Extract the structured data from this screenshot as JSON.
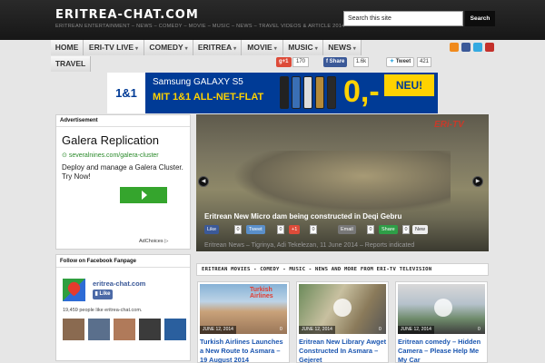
{
  "header": {
    "site_title": "ERITREA-CHAT.COM",
    "tagline": "ERITREAN ENTERTAINMENT – NEWS – COMEDY – MOVIE – MUSIC – NEWS – TRAVEL VIDEOS & ARTICLE 2014",
    "search_value": "Search this site",
    "search_button": "Search"
  },
  "nav": {
    "items": [
      {
        "label": "HOME",
        "dropdown": false
      },
      {
        "label": "ERI-TV LIVE",
        "dropdown": true
      },
      {
        "label": "COMEDY",
        "dropdown": true
      },
      {
        "label": "ERITREA",
        "dropdown": true
      },
      {
        "label": "MOVIE",
        "dropdown": true
      },
      {
        "label": "MUSIC",
        "dropdown": true
      },
      {
        "label": "NEWS",
        "dropdown": true
      },
      {
        "label": "TRAVEL",
        "dropdown": false
      }
    ],
    "social_icons": [
      "rss-icon",
      "facebook-icon",
      "twitter-icon",
      "youtube-icon"
    ]
  },
  "share_bar": {
    "gplus_label": "g+1",
    "gplus_count": "170",
    "fb_label": "Share",
    "fb_count": "1.6k",
    "tweet_label": "Tweet",
    "tweet_count": "421"
  },
  "banner": {
    "brand": "1&1",
    "line1": "Samsung GALAXY S5",
    "line2": "MIT 1&1 ALL-NET-FLAT",
    "price": "0,-",
    "badge": "NEU!",
    "colors": {
      "bg": "#003b96",
      "accent": "#ffd200"
    }
  },
  "ad": {
    "heading": "Advertisement",
    "title": "Galera Replication",
    "url": "severalnines.com/galera-cluster",
    "description": "Deploy and manage a Galera Cluster. Try Now!",
    "choices": "AdChoices"
  },
  "slider": {
    "channel_logo": "ERi-TV",
    "title": "Eritrean New Micro dam being constructed in Deqi Gebru",
    "share_buttons": [
      {
        "label": "Like",
        "count": "0"
      },
      {
        "label": "Tweet",
        "count": "0"
      },
      {
        "label": "+1",
        "count": "0"
      },
      {
        "label": "Email",
        "count": "0"
      },
      {
        "label": "Share",
        "count": "0"
      },
      {
        "label": "New",
        "count": ""
      }
    ],
    "excerpt": "Eritrean News – Tigrinya, Adi Tekelezan, 11 June 2014 – Reports indicated"
  },
  "facebook": {
    "heading": "Follow on Facebook Fanpage",
    "page_name": "eritrea-chat.com",
    "like_label": "Like",
    "count_text": "19,459 people like eritrea-chat.com."
  },
  "section": {
    "heading": "ERITREAN MOVIES - COMEDY - MUSIC - NEWS AND MORE FROM ERI-TV TELEVISION"
  },
  "cards": [
    {
      "date": "JUNE 12, 2014",
      "comments": "0",
      "title": "Turkish Airlines Launches a New Route to Asmara – 19 August 2014",
      "overlay": "Turkish Airlines"
    },
    {
      "date": "JUNE 12, 2014",
      "comments": "0",
      "title": "Eritrean New Library Awget Constructed In Asmara – Gejeret",
      "overlay": ""
    },
    {
      "date": "JUNE 12, 2014",
      "comments": "0",
      "title": "Eritrean comedy – Hidden Camera – Please Help Me My Car",
      "overlay": ""
    }
  ]
}
